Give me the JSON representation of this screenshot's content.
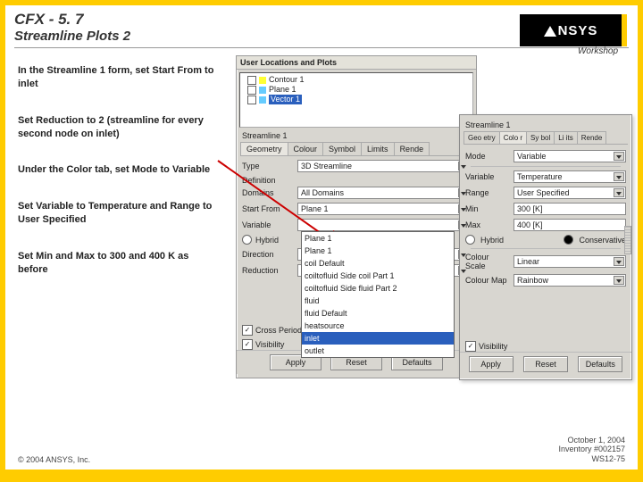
{
  "header": {
    "title1": "CFX - 5. 7",
    "title2": "Streamline Plots 2",
    "workshop": "Workshop",
    "logo": "NSYS"
  },
  "instructions": [
    "In the Streamline 1 form, set Start From to inlet",
    "Set Reduction to 2 (streamline for every second node on inlet)",
    "Under the Color tab, set Mode to Variable",
    "Set Variable to Temperature and Range to User Specified",
    "Set Min and Max to 300 and 400 K as before"
  ],
  "tree": {
    "header": "User Locations and Plots",
    "items": [
      "Contour 1",
      "Plane 1",
      "Vector 1"
    ]
  },
  "dlg1": {
    "title": "Streamline 1",
    "tabs": [
      "Geometry",
      "Colour",
      "Symbol",
      "Limits",
      "Rende"
    ],
    "fields": {
      "type_label": "Type",
      "type_value": "3D Streamline",
      "definition_label": "Definition",
      "domains_label": "Domains",
      "domains_value": "All Domains",
      "startfrom_label": "Start From",
      "startfrom_value": "Plane 1",
      "variable_label": "Variable",
      "hybrid_label": "Hybrid",
      "direction_label": "Direction",
      "reduction_label": "Reduction",
      "crossperiodics_label": "Cross Periodics",
      "visibility_label": "Visibility"
    },
    "dropdown": [
      "Plane 1",
      "Plane 1",
      "coil Default",
      "coiltofluid Side coil Part 1",
      "coiltofluid Side fluid Part 2",
      "fluid",
      "fluid Default",
      "heatsource",
      "inlet",
      "outlet"
    ],
    "buttons": {
      "apply": "Apply",
      "reset": "Reset",
      "defaults": "Defaults"
    }
  },
  "dlg2": {
    "title": "Streamline 1",
    "tabs": [
      "Geo etry",
      "Colo r",
      "Sy bol",
      "Li its",
      "Rende"
    ],
    "fields": {
      "mode_label": "Mode",
      "mode_value": "Variable",
      "variable_label": "Variable",
      "variable_value": "Temperature",
      "range_label": "Range",
      "range_value": "User Specified",
      "min_label": "Min",
      "min_value": "300 [K]",
      "max_label": "Max",
      "max_value": "400 [K]",
      "hybrid": "Hybrid",
      "conservative": "Conservative",
      "colourscale_label": "Colour Scale",
      "colourscale_value": "Linear",
      "colourmap_label": "Colour Map",
      "colourmap_value": "Rainbow",
      "visibility_label": "Visibility"
    },
    "buttons": {
      "apply": "Apply",
      "reset": "Reset",
      "defaults": "Defaults"
    }
  },
  "footer": {
    "left": "© 2004 ANSYS, Inc.",
    "right1": "October 1, 2004",
    "right2": "Inventory #002157",
    "right3": "WS12-75"
  }
}
